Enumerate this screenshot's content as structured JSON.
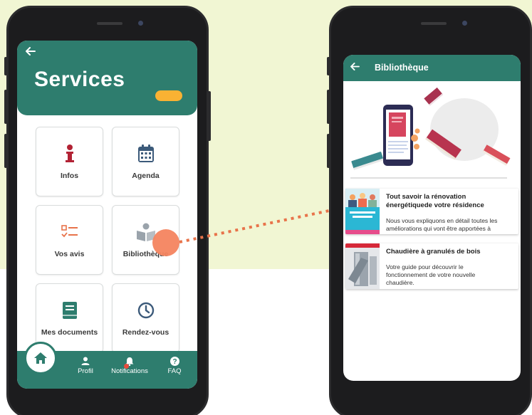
{
  "left_app": {
    "title": "Services",
    "back_icon": "arrow-left-icon",
    "tiles": [
      {
        "label": "Infos",
        "icon": "info-icon",
        "color": "#b22234"
      },
      {
        "label": "Agenda",
        "icon": "calendar-icon",
        "color": "#3c5a7a"
      },
      {
        "label": "Vos avis",
        "icon": "checklist-icon",
        "color": "#e8734a"
      },
      {
        "label": "Bibliothèque",
        "icon": "reading-icon",
        "color": "#9aa3ab"
      },
      {
        "label": "Mes documents",
        "icon": "book-icon",
        "color": "#2e7d6e"
      },
      {
        "label": "Rendez-vous",
        "icon": "clock-icon",
        "color": "#3c5a7a"
      }
    ],
    "bottom_nav": {
      "home_icon": "home-icon",
      "items": [
        {
          "label": "Profil",
          "icon": "person-icon"
        },
        {
          "label": "Notifications",
          "icon": "bell-icon"
        },
        {
          "label": "FAQ",
          "icon": "help-icon"
        }
      ]
    }
  },
  "right_app": {
    "title": "Bibliothèque",
    "back_icon": "arrow-left-icon",
    "documents": [
      {
        "title_line1": "Tout savoir la rénovation",
        "title_line2": "énergétiquede votre résidence",
        "desc_line1": "Nous vous expliquons en détail toutes les",
        "desc_line2": "améliorations qui vont être apportées à"
      },
      {
        "title_line1": "Chaudière à granulés de bois",
        "desc_line1": "Votre guide pour découvrir le",
        "desc_line2": "fonctionnement de votre nouvelle",
        "desc_line3": "chaudière."
      }
    ]
  },
  "colors": {
    "primary": "#2e7d6e",
    "accent": "#f9b233",
    "highlight": "#f4845f",
    "background": "#f1f6d3"
  }
}
